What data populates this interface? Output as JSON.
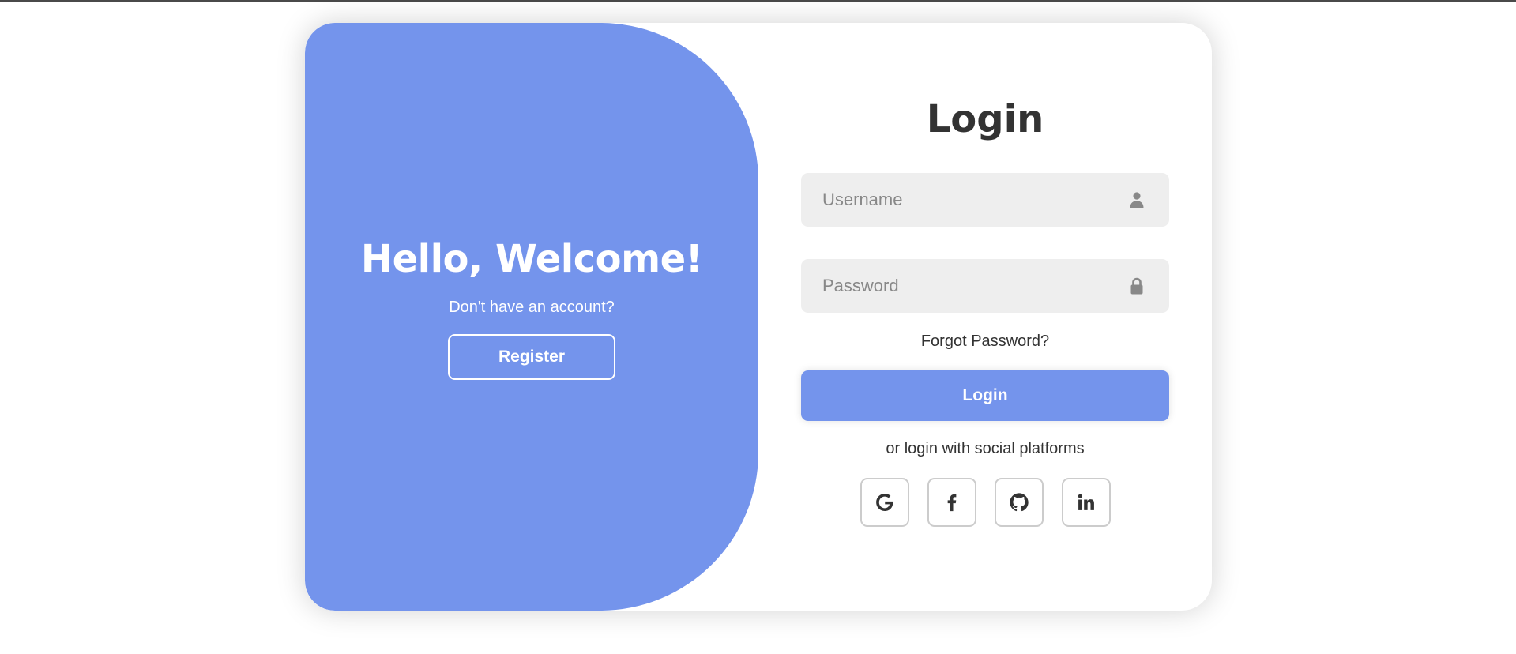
{
  "welcome": {
    "title": "Hello, Welcome!",
    "subtitle": "Don't have an account?",
    "register_label": "Register"
  },
  "login_form": {
    "title": "Login",
    "username_placeholder": "Username",
    "password_placeholder": "Password",
    "forgot_label": "Forgot Password?",
    "login_label": "Login",
    "social_text": "or login with social platforms",
    "social_icons": [
      "google-icon",
      "facebook-icon",
      "github-icon",
      "linkedin-icon"
    ]
  },
  "colors": {
    "accent": "#7494ec",
    "text": "#333333",
    "input_bg": "#eeeeee",
    "placeholder": "#888888"
  }
}
